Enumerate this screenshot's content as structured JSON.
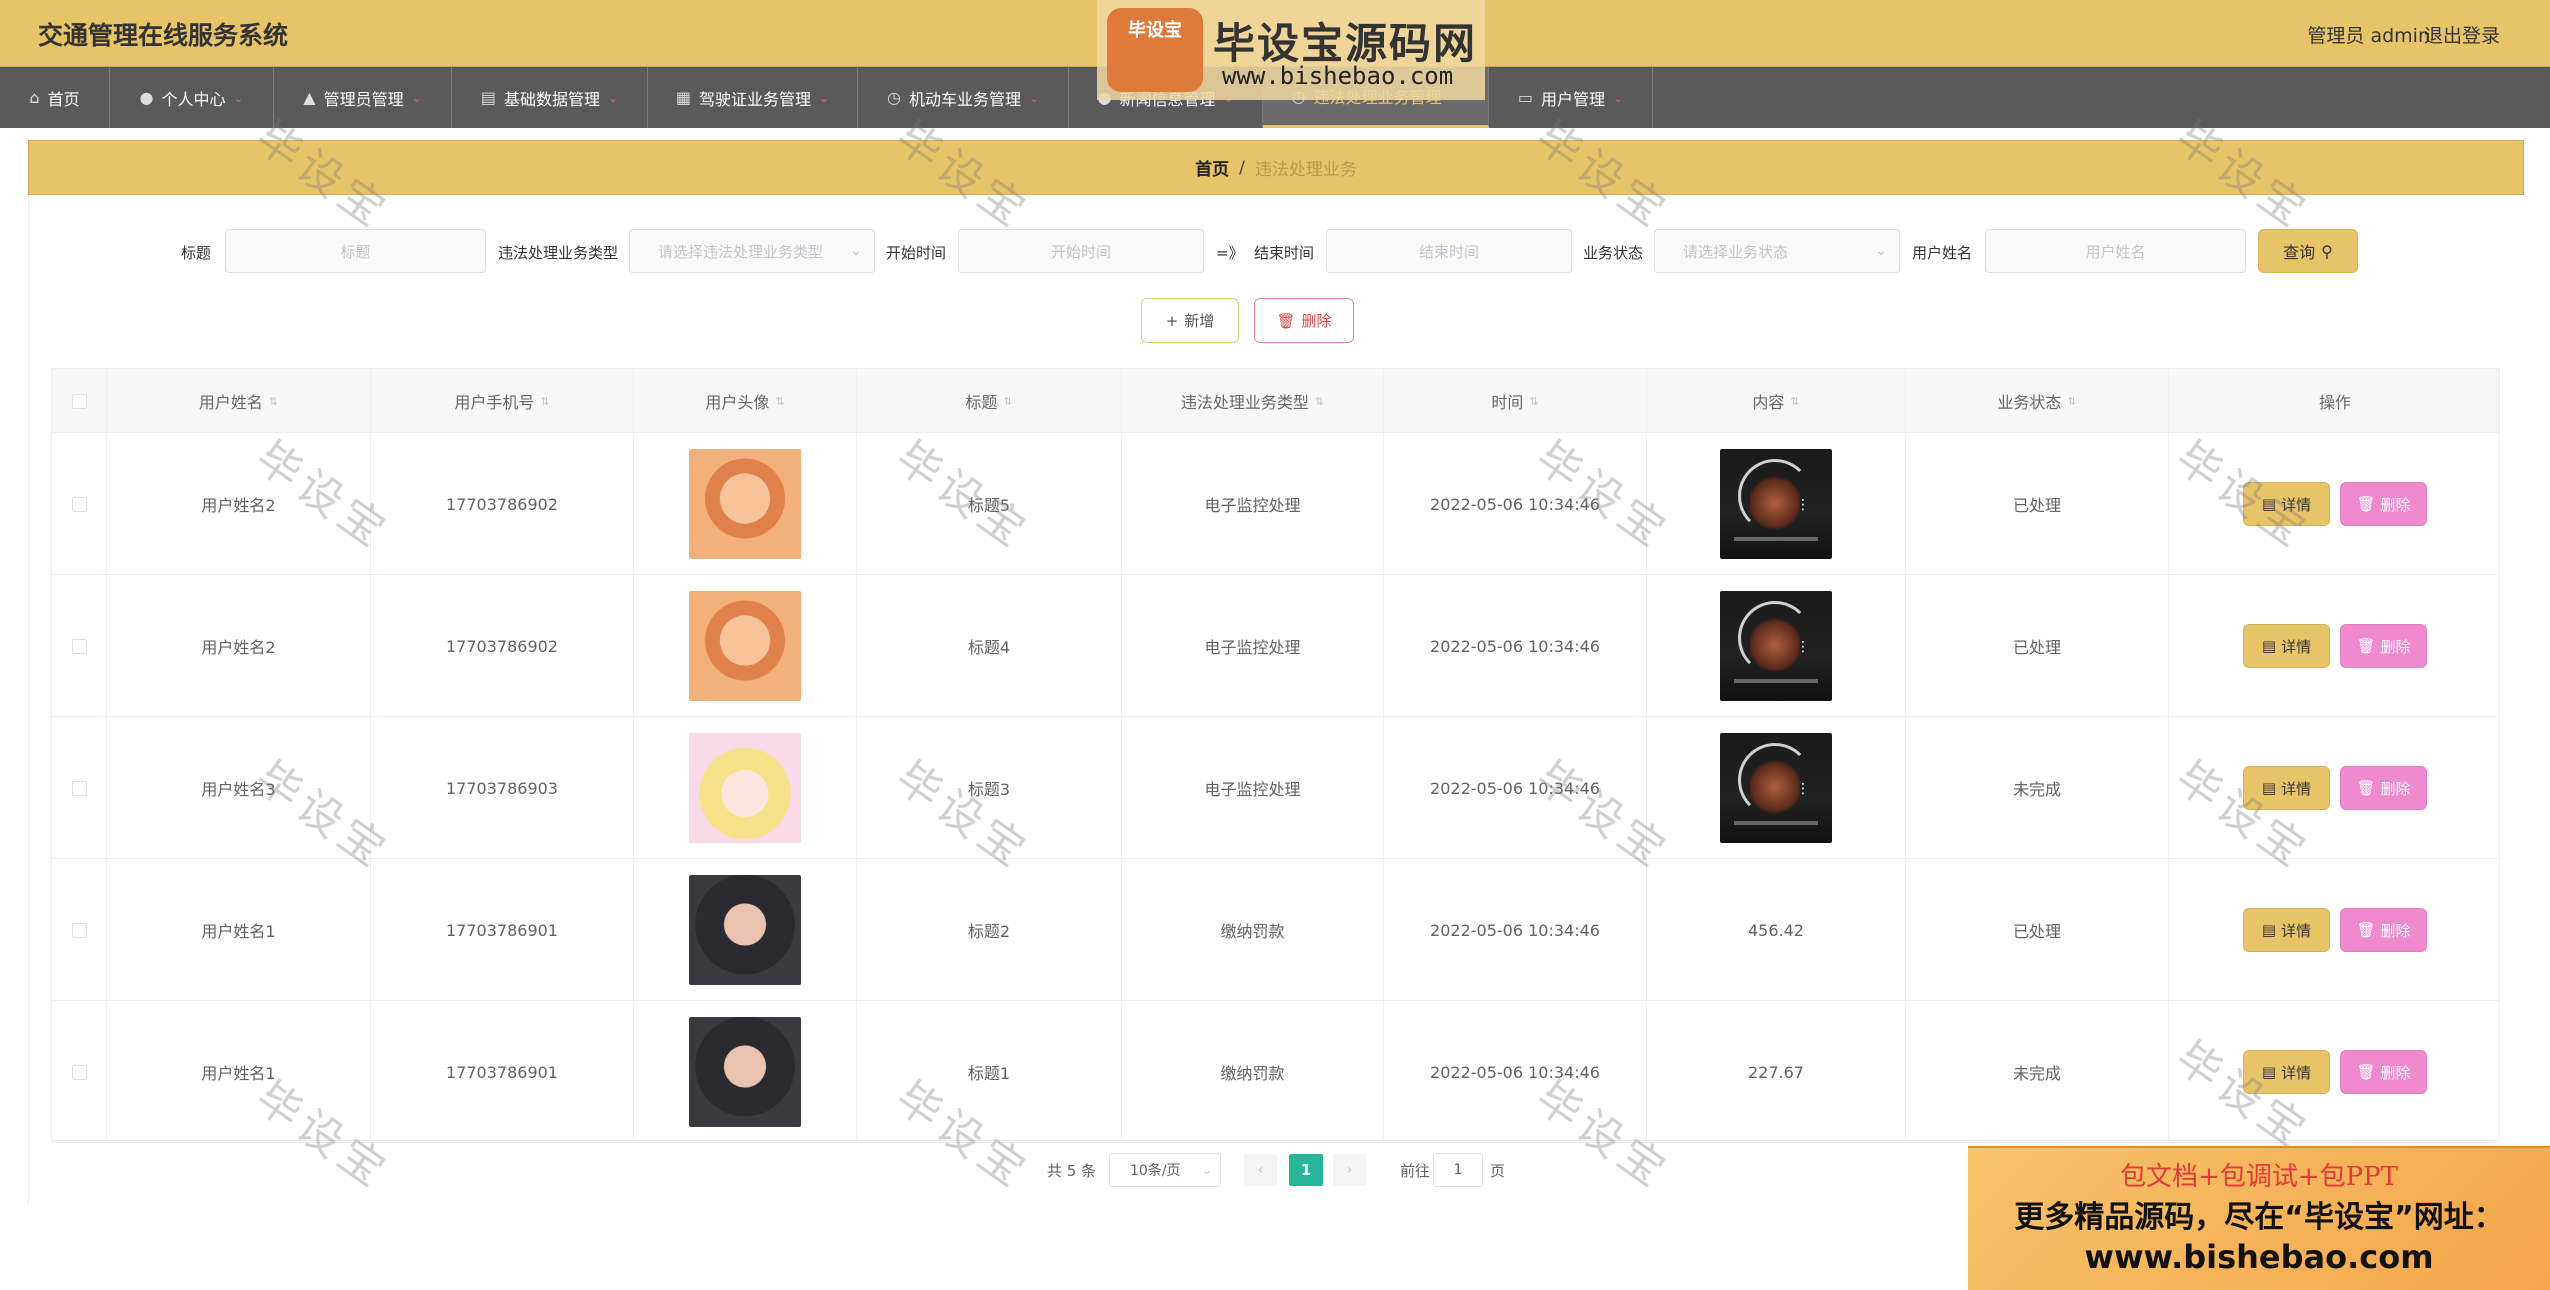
{
  "header": {
    "title": "交通管理在线服务系统",
    "user": "管理员 admin",
    "logout": "退出登录"
  },
  "nav": [
    {
      "label": "首页"
    },
    {
      "label": "个人中心"
    },
    {
      "label": "管理员管理"
    },
    {
      "label": "基础数据管理"
    },
    {
      "label": "驾驶证业务管理"
    },
    {
      "label": "机动车业务管理"
    },
    {
      "label": "新闻信息管理"
    },
    {
      "label": "违法处理业务管理"
    },
    {
      "label": "用户管理"
    }
  ],
  "breadcrumb": {
    "home": "首页",
    "sep": "/",
    "current": "违法处理业务"
  },
  "filters": {
    "title_label": "标题",
    "title_placeholder": "标题",
    "type_label": "违法处理业务类型",
    "type_placeholder": "请选择违法处理业务类型",
    "start_label": "开始时间",
    "start_placeholder": "开始时间",
    "range_sep": "=》",
    "end_label": "结束时间",
    "end_placeholder": "结束时间",
    "status_label": "业务状态",
    "status_placeholder": "请选择业务状态",
    "username_label": "用户姓名",
    "username_placeholder": "用户姓名",
    "query": "查询"
  },
  "actions": {
    "add": "新增",
    "delete": "删除"
  },
  "table": {
    "headers": [
      "用户姓名",
      "用户手机号",
      "用户头像",
      "标题",
      "违法处理业务类型",
      "时间",
      "内容",
      "业务状态",
      "操作"
    ],
    "rows": [
      {
        "name": "用户姓名2",
        "phone": "17703786902",
        "avatar": "avatar-a",
        "title": "标题5",
        "type": "电子监控处理",
        "time": "2022-05-06 10:34:46",
        "content": "",
        "content_kind": "video",
        "status": "已处理"
      },
      {
        "name": "用户姓名2",
        "phone": "17703786902",
        "avatar": "avatar-a",
        "title": "标题4",
        "type": "电子监控处理",
        "time": "2022-05-06 10:34:46",
        "content": "",
        "content_kind": "video",
        "status": "已处理"
      },
      {
        "name": "用户姓名3",
        "phone": "17703786903",
        "avatar": "avatar-b",
        "title": "标题3",
        "type": "电子监控处理",
        "time": "2022-05-06 10:34:46",
        "content": "",
        "content_kind": "video",
        "status": "未完成"
      },
      {
        "name": "用户姓名1",
        "phone": "17703786901",
        "avatar": "avatar-c",
        "title": "标题2",
        "type": "缴纳罚款",
        "time": "2022-05-06 10:34:46",
        "content": "456.42",
        "content_kind": "text",
        "status": "已处理"
      },
      {
        "name": "用户姓名1",
        "phone": "17703786901",
        "avatar": "avatar-c",
        "title": "标题1",
        "type": "缴纳罚款",
        "time": "2022-05-06 10:34:46",
        "content": "227.67",
        "content_kind": "text",
        "status": "未完成"
      }
    ],
    "detail_label": "详情",
    "delete_label": "删除"
  },
  "pagination": {
    "total": "共 5 条",
    "page_size": "10条/页",
    "current": "1",
    "goto_label": "前往",
    "goto_value": "1",
    "page_suffix": "页"
  },
  "watermark": {
    "text": "毕设宝",
    "logo_badge": "毕设宝",
    "logo_text": "毕设宝源码网",
    "logo_url": "www.bishebao.com"
  },
  "promo": {
    "line1": "包文档+包调试+包PPT",
    "line2": "更多精品源码，尽在“毕设宝”网址：",
    "line3": "www.bishebao.com"
  },
  "colors": {
    "accent": "#e8c468",
    "nav": "#5a5a5a",
    "delete": "#f08ad0",
    "page_active": "#27b59a"
  }
}
